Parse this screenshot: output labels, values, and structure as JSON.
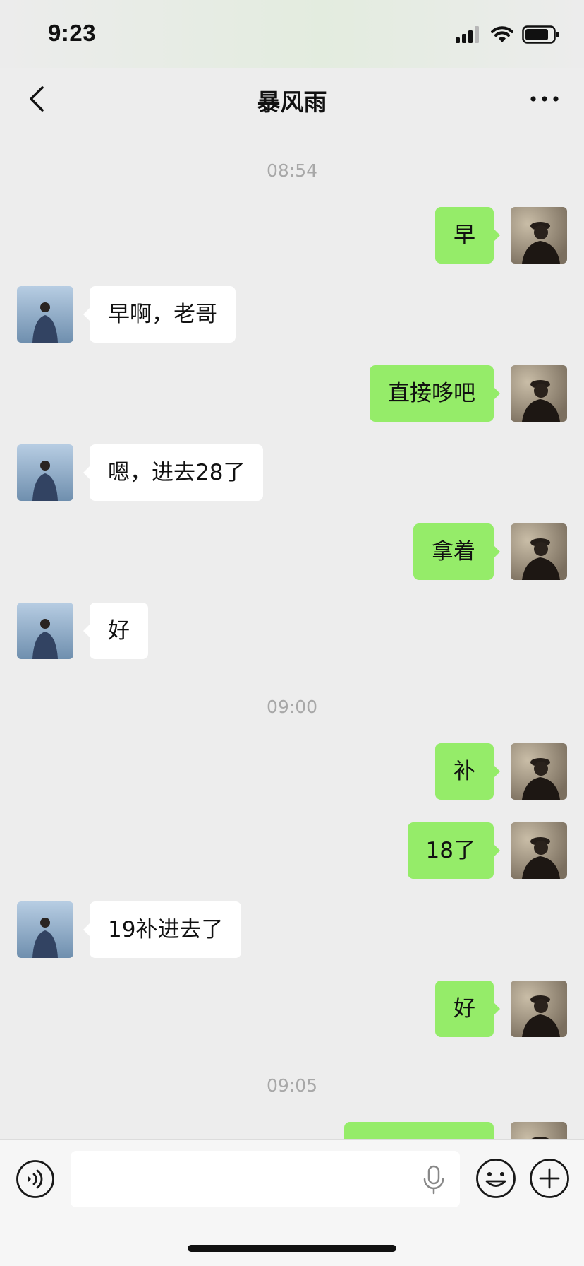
{
  "status_bar": {
    "time": "9:23",
    "icons": [
      "signal-icon",
      "wifi-icon",
      "battery-icon"
    ]
  },
  "header": {
    "title": "暴风雨",
    "back_icon": "chevron-left-icon",
    "more_icon": "more-icon"
  },
  "messages": {
    "time1": "08:54",
    "m1": "早",
    "m2": "早啊，老哥",
    "m3": "直接哆吧",
    "m4": "嗯，进去28了",
    "m5": "拿着",
    "m6": "好",
    "time2": "09:00",
    "m7": "补",
    "m8": "18了",
    "m9": "19补进去了",
    "m10": "好",
    "time3": "09:05",
    "m11": ""
  },
  "input_bar": {
    "value": "",
    "icons": [
      "voice-icon",
      "mic-icon",
      "emoji-icon",
      "plus-icon"
    ]
  },
  "colors": {
    "background": "#ededed",
    "my_bubble": "#95ec69",
    "other_bubble": "#ffffff",
    "timestamp": "#a8a8a8"
  }
}
